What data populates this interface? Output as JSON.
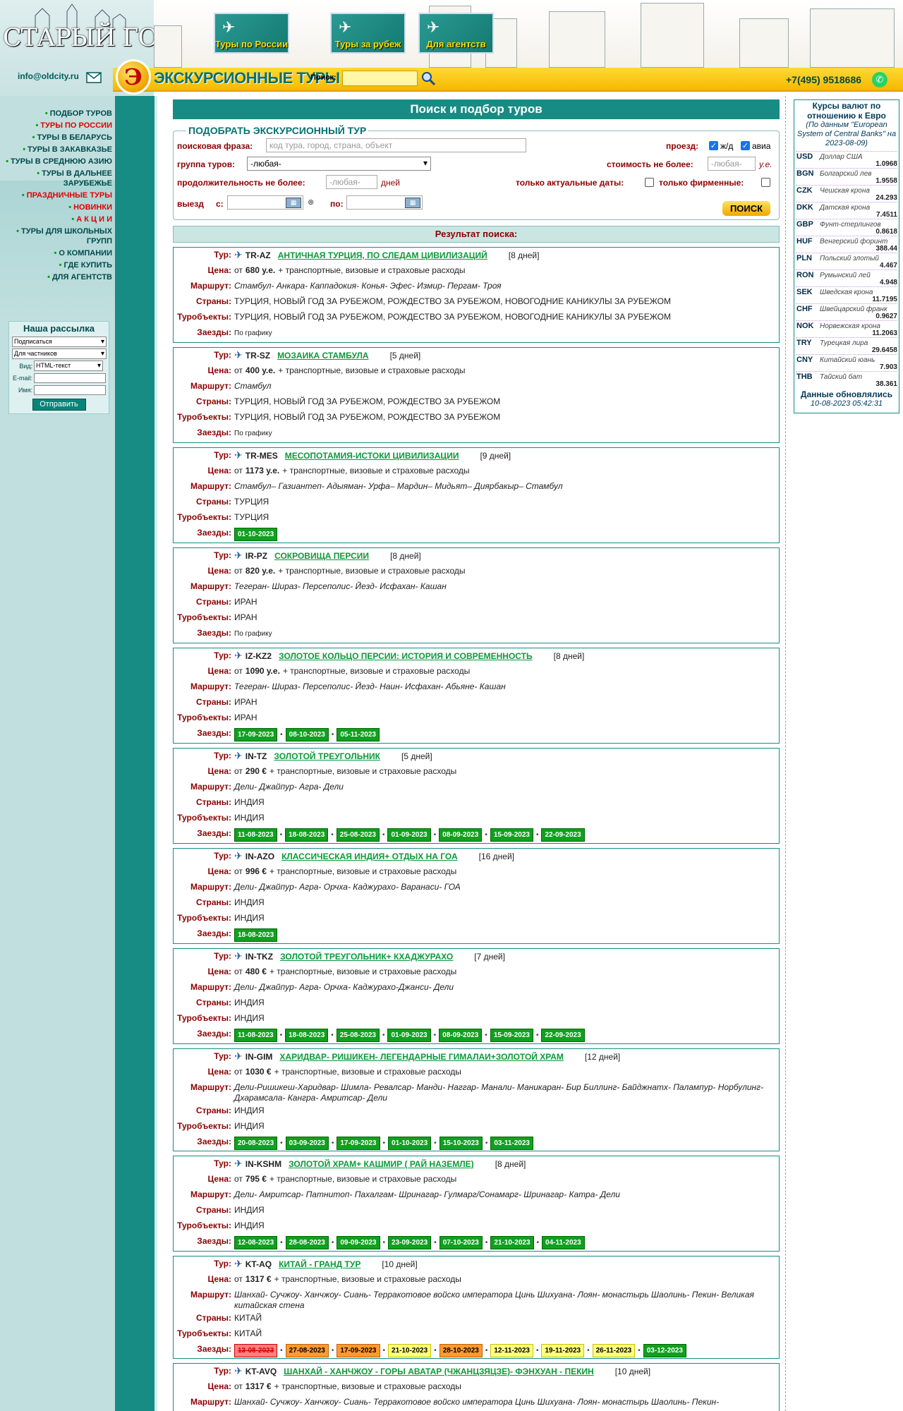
{
  "header": {
    "logo": "СТАРЫЙ ГОРОД",
    "email": "info@oldcity.ru",
    "site_title": "ЭКСКУРСИОННЫЕ ТУРЫ",
    "circle_letter": "Э",
    "search_label": "Поиск:",
    "phone": "+7(495) 9518686",
    "banners": [
      "Туры по России",
      "Туры за рубеж",
      "Для агентств"
    ]
  },
  "nav": [
    {
      "label": "ПОДБОР ТУРОВ",
      "red": false
    },
    {
      "label": "ТУРЫ ПО РОССИИ",
      "red": true
    },
    {
      "label": "ТУРЫ В БЕЛАРУСЬ",
      "red": false
    },
    {
      "label": "ТУРЫ В ЗАКАВКАЗЬЕ",
      "red": false
    },
    {
      "label": "ТУРЫ В СРЕДНЮЮ АЗИЮ",
      "red": false
    },
    {
      "label": "ТУРЫ В ДАЛЬНЕЕ ЗАРУБЕЖЬЕ",
      "red": false
    },
    {
      "label": "ПРАЗДНИЧНЫЕ ТУРЫ",
      "red": true
    },
    {
      "label": "НОВИНКИ",
      "red": true
    },
    {
      "label": "А К Ц И И",
      "red": true
    },
    {
      "label": "ТУРЫ ДЛЯ ШКОЛЬНЫХ ГРУПП",
      "red": false
    },
    {
      "label": "О КОМПАНИИ",
      "red": false
    },
    {
      "label": "ГДЕ КУПИТЬ",
      "red": false
    },
    {
      "label": "ДЛЯ АГЕНТСТВ",
      "red": false
    }
  ],
  "newsletter": {
    "title": "Наша рассылка",
    "subscribe": "Подписаться",
    "audience": "Для частников",
    "view_label": "Вид:",
    "view": "HTML-текст",
    "email_label": "E-mail:",
    "name_label": "Имя:",
    "submit": "Отправить"
  },
  "search": {
    "title": "Поиск и подбор туров",
    "legend": "ПОДОБРАТЬ ЭКСКУРСИОННЫЙ ТУР",
    "phrase_label": "поисковая фраза:",
    "phrase_placeholder": "код тура, город, страна, объект",
    "travel_label": "проезд:",
    "rail": "ж/д",
    "air": "авиа",
    "group_label": "группа туров:",
    "group_value": "-любая-",
    "cost_label": "стоимость не более:",
    "cost_placeholder": "-любая-",
    "cost_unit": "у.е.",
    "dur_label": "продолжительность не более:",
    "dur_placeholder": "-любая-",
    "dur_unit": "дней",
    "actual_label": "только актуальные даты:",
    "brand_label": "только фирменные:",
    "depart_label": "выезд",
    "from_label": "с:",
    "to_label": "по:",
    "button": "ПОИСК",
    "results": "Результат поиска:"
  },
  "labels": {
    "tour": "Тур:",
    "price": "Цена:",
    "route": "Маршрут:",
    "countries": "Страны:",
    "objects": "Туробъекты:",
    "dates": "Заезды:",
    "price_from": "от",
    "extra": "+ транспортные, визовые и страховые расходы"
  },
  "tours": [
    {
      "code": "TR-AZ",
      "name": "АНТИЧНАЯ ТУРЦИЯ, ПО СЛЕДАМ ЦИВИЛИЗАЦИЙ",
      "days": "[8 дней]",
      "price": "680 у.е.",
      "route": "Стамбул- Анкара- Каппадокия- Конья- Эфес- Измир- Пергам- Троя",
      "countries": "ТУРЦИЯ, НОВЫЙ ГОД ЗА РУБЕЖОМ, РОЖДЕСТВО ЗА РУБЕЖОМ, НОВОГОДНИЕ КАНИКУЛЫ ЗА РУБЕЖОМ",
      "objects": "ТУРЦИЯ, НОВЫЙ ГОД ЗА РУБЕЖОМ, РОЖДЕСТВО ЗА РУБЕЖОМ, НОВОГОДНИЕ КАНИКУЛЫ ЗА РУБЕЖОМ",
      "schedule": "По графику",
      "dates": []
    },
    {
      "code": "TR-SZ",
      "name": "МОЗАИКА СТАМБУЛА",
      "days": "[5 дней]",
      "price": "400 у.е.",
      "route": "Стамбул",
      "countries": "ТУРЦИЯ, НОВЫЙ ГОД ЗА РУБЕЖОМ, РОЖДЕСТВО ЗА РУБЕЖОМ",
      "objects": "ТУРЦИЯ, НОВЫЙ ГОД ЗА РУБЕЖОМ, РОЖДЕСТВО ЗА РУБЕЖОМ",
      "schedule": "По графику",
      "dates": []
    },
    {
      "code": "TR-MES",
      "name": "МЕСОПОТАМИЯ-ИСТОКИ ЦИВИЛИЗАЦИИ",
      "days": "[9 дней]",
      "price": "1173 у.е.",
      "route": "Стамбул– Газиантеп- Адыяман- Урфа– Мардин– Мидьят– Диярбакыр– Стамбул",
      "countries": "ТУРЦИЯ",
      "objects": "ТУРЦИЯ",
      "schedule": "",
      "dates": [
        {
          "d": "01-10-2023",
          "c": "g"
        }
      ]
    },
    {
      "code": "IR-PZ",
      "name": "СОКРОВИЩА ПЕРСИИ",
      "days": "[8 дней]",
      "price": "820 у.е.",
      "route": "Тегеран- Шираз- Персеполис- Йезд- Исфахан- Кашан",
      "countries": "ИРАН",
      "objects": "ИРАН",
      "schedule": "По графику",
      "dates": []
    },
    {
      "code": "IZ-KZ2",
      "name": "ЗОЛОТОЕ КОЛЬЦО ПЕРСИИ: ИСТОРИЯ И СОВРЕМЕННОСТЬ",
      "days": "[8 дней]",
      "price": "1090 у.е.",
      "route": "Тегеран- Шираз- Персеполис- Йезд- Наин- Исфахан- Абьяне- Кашан",
      "countries": "ИРАН",
      "objects": "ИРАН",
      "schedule": "",
      "dates": [
        {
          "d": "17-09-2023",
          "c": "g"
        },
        {
          "d": "08-10-2023",
          "c": "g"
        },
        {
          "d": "05-11-2023",
          "c": "g"
        }
      ]
    },
    {
      "code": "IN-TZ",
      "name": "ЗОЛОТОЙ ТРЕУГОЛЬНИК",
      "days": "[5 дней]",
      "price": "290 €",
      "route": "Дели- Джайпур- Агра- Дели",
      "countries": "ИНДИЯ",
      "objects": "ИНДИЯ",
      "schedule": "",
      "dates": [
        {
          "d": "11-08-2023",
          "c": "g"
        },
        {
          "d": "18-08-2023",
          "c": "g"
        },
        {
          "d": "25-08-2023",
          "c": "g"
        },
        {
          "d": "01-09-2023",
          "c": "g"
        },
        {
          "d": "08-09-2023",
          "c": "g"
        },
        {
          "d": "15-09-2023",
          "c": "g"
        },
        {
          "d": "22-09-2023",
          "c": "g"
        }
      ]
    },
    {
      "code": "IN-AZO",
      "name": "КЛАССИЧЕСКАЯ ИНДИЯ+ ОТДЫХ НА ГОА",
      "days": "[16 дней]",
      "price": "996 €",
      "route": "Дели- Джайпур- Агра- Орчха- Каджурахо- Варанаси- ГОА",
      "countries": "ИНДИЯ",
      "objects": "ИНДИЯ",
      "schedule": "",
      "dates": [
        {
          "d": "18-08-2023",
          "c": "g"
        }
      ]
    },
    {
      "code": "IN-TKZ",
      "name": "ЗОЛОТОЙ ТРЕУГОЛЬНИК+ КХАДЖУРАХО",
      "days": "[7 дней]",
      "price": "480 €",
      "route": "Дели- Джайпур- Агра- Орчха- Каджурахо-Джанси- Дели",
      "countries": "ИНДИЯ",
      "objects": "ИНДИЯ",
      "schedule": "",
      "dates": [
        {
          "d": "11-08-2023",
          "c": "g"
        },
        {
          "d": "18-08-2023",
          "c": "g"
        },
        {
          "d": "25-08-2023",
          "c": "g"
        },
        {
          "d": "01-09-2023",
          "c": "g"
        },
        {
          "d": "08-09-2023",
          "c": "g"
        },
        {
          "d": "15-09-2023",
          "c": "g"
        },
        {
          "d": "22-09-2023",
          "c": "g"
        }
      ]
    },
    {
      "code": "IN-GIM",
      "name": "ХАРИДВАР- РИШИКЕН- ЛЕГЕНДАРНЫЕ ГИМАЛАИ+ЗОЛОТОЙ ХРАМ",
      "days": "[12 дней]",
      "price": "1030 €",
      "route": "Дели-Ришикеш-Харидвар- Шимла- Ревалсар- Манди- Наггар- Манали- Маникаран- Бир Биллинг- Байджнатх- Палампур- Норбулинг- Дхарамсала- Кангра- Амритсар- Дели",
      "countries": "ИНДИЯ",
      "objects": "ИНДИЯ",
      "schedule": "",
      "dates": [
        {
          "d": "20-08-2023",
          "c": "g"
        },
        {
          "d": "03-09-2023",
          "c": "g"
        },
        {
          "d": "17-09-2023",
          "c": "g"
        },
        {
          "d": "01-10-2023",
          "c": "g"
        },
        {
          "d": "15-10-2023",
          "c": "g"
        },
        {
          "d": "03-11-2023",
          "c": "g"
        }
      ]
    },
    {
      "code": "IN-KSHM",
      "name": "ЗОЛОТОЙ ХРАМ+ КАШМИР ( РАЙ НАЗЕМЛЕ)",
      "days": "[8 дней]",
      "price": "795 €",
      "route": "Дели- Амритсар- Патнитоп- Пахалгам- Шринагар- Гулмарг/Сонамарг- Шринагар- Катра- Дели",
      "countries": "ИНДИЯ",
      "objects": "ИНДИЯ",
      "schedule": "",
      "dates": [
        {
          "d": "12-08-2023",
          "c": "g"
        },
        {
          "d": "28-08-2023",
          "c": "g"
        },
        {
          "d": "09-09-2023",
          "c": "g"
        },
        {
          "d": "23-09-2023",
          "c": "g"
        },
        {
          "d": "07-10-2023",
          "c": "g"
        },
        {
          "d": "21-10-2023",
          "c": "g"
        },
        {
          "d": "04-11-2023",
          "c": "g"
        }
      ]
    },
    {
      "code": "KT-AQ",
      "name": "КИТАЙ - ГРАНД ТУР",
      "days": "[10 дней]",
      "price": "1317 €",
      "route": "Шанхай- Сучжоу- Ханчжоу- Сиань- Терракотовое войско императора Цинь Шихуана- Лоян- монастырь Шаолинь- Пекин- Великая китайская стена",
      "countries": "КИТАЙ",
      "objects": "КИТАЙ",
      "schedule": "",
      "dates": [
        {
          "d": "13-08-2023",
          "c": "r"
        },
        {
          "d": "27-08-2023",
          "c": "o"
        },
        {
          "d": "17-09-2023",
          "c": "o"
        },
        {
          "d": "21-10-2023",
          "c": "y"
        },
        {
          "d": "28-10-2023",
          "c": "o"
        },
        {
          "d": "12-11-2023",
          "c": "y"
        },
        {
          "d": "19-11-2023",
          "c": "y"
        },
        {
          "d": "26-11-2023",
          "c": "y"
        },
        {
          "d": "03-12-2023",
          "c": "g"
        }
      ]
    },
    {
      "code": "KT-AVQ",
      "name": "ШАНХАЙ - ХАНЧЖОУ - ГОРЫ АВАТАР (ЧЖАНЦЗЯЦЗЕ)- ФЭНХУАН - ПЕКИН",
      "days": "[10 дней]",
      "price": "1317 €",
      "route": "Шанхай- Сучжоу- Ханчжоу- Сиань- Терракотовое войско императора Цинь Шихуана- Лоян- монастырь Шаолинь- Пекин-",
      "countries": "",
      "objects": "",
      "schedule": "",
      "dates": []
    }
  ],
  "rates": {
    "title": "Курсы валют по отношению к Евро",
    "sub": "(По данным \"European System of Central Banks\" на 2023-08-09)",
    "updated": "Данные обновлялись",
    "updated_at": "10-08-2023 05:42:31",
    "items": [
      {
        "c": "USD",
        "n": "Доллар США",
        "v": "1.0968"
      },
      {
        "c": "BGN",
        "n": "Болгарский лев",
        "v": "1.9558"
      },
      {
        "c": "CZK",
        "n": "Чешская крона",
        "v": "24.293"
      },
      {
        "c": "DKK",
        "n": "Датская крона",
        "v": "7.4511"
      },
      {
        "c": "GBP",
        "n": "Фунт-стерлингов",
        "v": "0.8618"
      },
      {
        "c": "HUF",
        "n": "Венгерский форинт",
        "v": "388.44"
      },
      {
        "c": "PLN",
        "n": "Польский злотый",
        "v": "4.467"
      },
      {
        "c": "RON",
        "n": "Румынский лей",
        "v": "4.948"
      },
      {
        "c": "SEK",
        "n": "Шведская крона",
        "v": "11.7195"
      },
      {
        "c": "CHF",
        "n": "Швейцарский франк",
        "v": "0.9627"
      },
      {
        "c": "NOK",
        "n": "Норвежская крона",
        "v": "11.2063"
      },
      {
        "c": "TRY",
        "n": "Турецкая лира",
        "v": "29.6458"
      },
      {
        "c": "CNY",
        "n": "Китайский юань",
        "v": "7.903"
      },
      {
        "c": "THB",
        "n": "Тайский бат",
        "v": "38.361"
      }
    ]
  }
}
